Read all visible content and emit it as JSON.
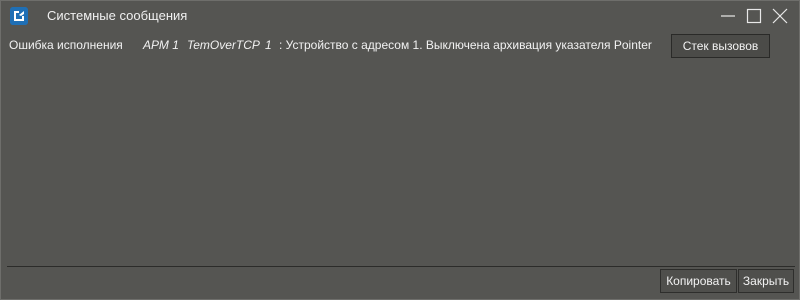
{
  "window": {
    "title": "Системные сообщения",
    "icon": "app-logo-icon",
    "controls": {
      "minimize": "minimize-icon",
      "maximize": "maximize-icon",
      "close": "close-icon"
    }
  },
  "messages": [
    {
      "type": "Ошибка исполнения",
      "arm": "АРМ 1",
      "device": "TemOverTCP",
      "number": "1",
      "text": ":  Устройство с адресом 1.  Выключена архивация указателя Pointer"
    }
  ],
  "buttons": {
    "call_stack": "Стек вызовов",
    "copy": "Копировать",
    "close": "Закрыть"
  },
  "colors": {
    "background": "#555552",
    "text": "#f2f2f2",
    "icon_blue": "#1f6fb5"
  }
}
